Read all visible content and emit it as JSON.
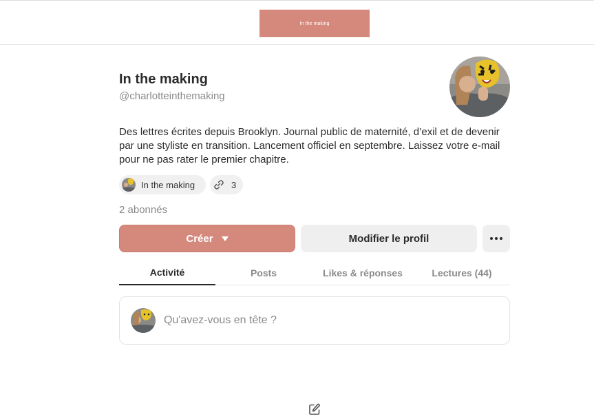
{
  "header": {
    "logo_text": "In the making",
    "logo_bg": "#d5897c"
  },
  "profile": {
    "name": "In the making",
    "handle": "@charlotteinthemaking",
    "bio": "Des lettres écrites depuis Brooklyn. Journal public de maternité, d’exil et de devenir par une styliste en transition. Lancement officiel en septembre. Laissez votre e-mail pour ne pas rater le premier chapitre.",
    "publication_chip_label": "In the making",
    "links_count": "3",
    "subscribers": "2 abonnés"
  },
  "actions": {
    "create_label": "Créer",
    "edit_profile_label": "Modifier le profil",
    "more_icon": "more-horizontal-icon"
  },
  "tabs": [
    {
      "label": "Activité",
      "active": true
    },
    {
      "label": "Posts",
      "active": false
    },
    {
      "label": "Likes & réponses",
      "active": false
    },
    {
      "label": "Lectures (44)",
      "active": false
    }
  ],
  "composer": {
    "placeholder": "Qu'avez-vous en tête ?"
  },
  "colors": {
    "accent": "#d5897c",
    "button_grey": "#efefef",
    "muted_text": "#8a8a8a"
  },
  "icons": {
    "link": "link-icon",
    "edit": "edit-pencil-icon"
  }
}
